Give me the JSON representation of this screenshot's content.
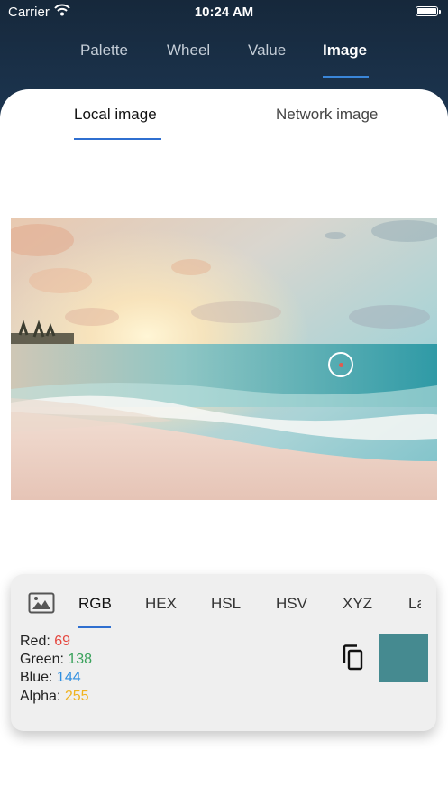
{
  "status_bar": {
    "carrier": "Carrier",
    "time": "10:24 AM"
  },
  "top_tabs": [
    {
      "label": "Palette"
    },
    {
      "label": "Wheel"
    },
    {
      "label": "Value"
    },
    {
      "label": "Image",
      "active": true
    }
  ],
  "sub_tabs": [
    {
      "label": "Local image",
      "active": true
    },
    {
      "label": "Network image"
    }
  ],
  "format_tabs": [
    {
      "label": "RGB",
      "active": true
    },
    {
      "label": "HEX"
    },
    {
      "label": "HSL"
    },
    {
      "label": "HSV"
    },
    {
      "label": "XYZ"
    },
    {
      "label": "La"
    }
  ],
  "channels": {
    "red": {
      "label": "Red:",
      "value": "69"
    },
    "green": {
      "label": "Green:",
      "value": "138"
    },
    "blue": {
      "label": "Blue:",
      "value": "144"
    },
    "alpha": {
      "label": "Alpha:",
      "value": "255"
    }
  },
  "colors": {
    "header": "#1a2f45",
    "accent": "#2f6fd0",
    "swatch": "#458A90",
    "red_value": "#e5473f",
    "green_value": "#3aa25c",
    "blue_value": "#2f8ee0",
    "alpha_value": "#f0b320"
  },
  "icons": {
    "wifi": "wifi-icon",
    "battery": "battery-icon",
    "image": "image-icon",
    "copy": "copy-icon"
  }
}
